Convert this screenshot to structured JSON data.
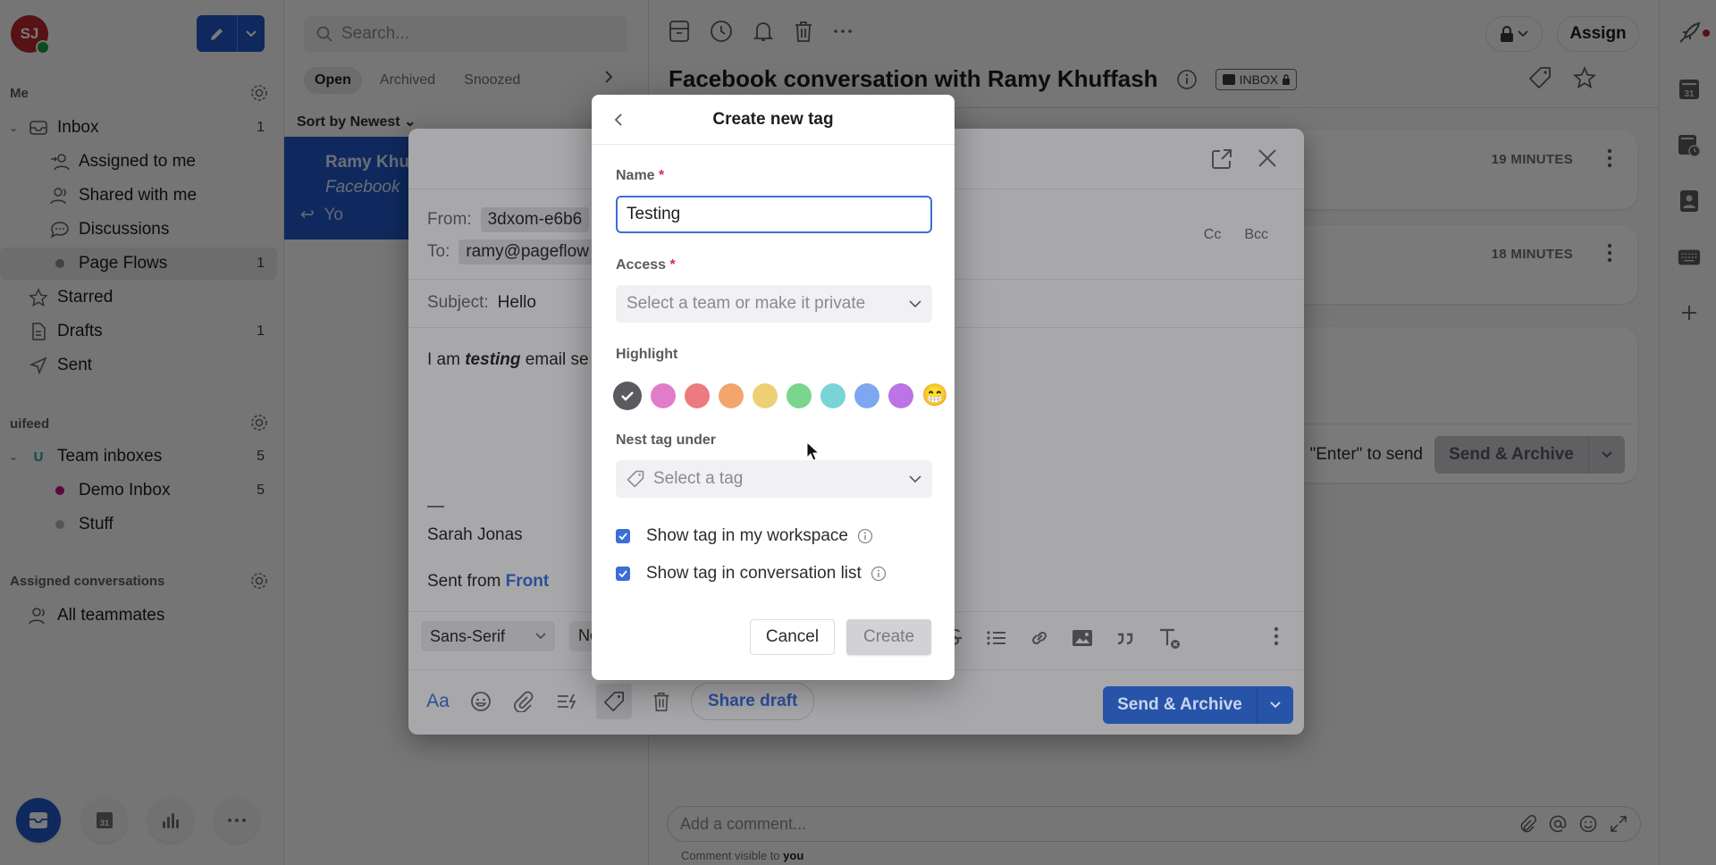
{
  "sidebar": {
    "user_initials": "SJ",
    "section_me": "Me",
    "me_items": [
      {
        "label": "Inbox",
        "count": "1"
      },
      {
        "label": "Assigned to me"
      },
      {
        "label": "Shared with me"
      },
      {
        "label": "Discussions"
      },
      {
        "label": "Page Flows",
        "count": "1",
        "dot_color": "#8a8a8f"
      },
      {
        "label": "Starred"
      },
      {
        "label": "Drafts",
        "count": "1"
      },
      {
        "label": "Sent"
      }
    ],
    "section_workspace": "uifeed",
    "team_inboxes": {
      "label": "Team inboxes",
      "count": "5",
      "badge": "U"
    },
    "team_items": [
      {
        "label": "Demo Inbox",
        "count": "5",
        "dot_color": "#b3157a"
      },
      {
        "label": "Stuff",
        "dot_color": "#b0b0b4"
      }
    ],
    "section_assigned": "Assigned conversations",
    "assigned_items": [
      {
        "label": "All teammates"
      }
    ]
  },
  "list": {
    "search_placeholder": "Search...",
    "tabs": [
      "Open",
      "Archived",
      "Snoozed"
    ],
    "active_tab": "Open",
    "sort_label": "Sort by Newest",
    "item": {
      "name": "Ramy Khu",
      "subtitle": "Facebook",
      "snippet": "Yo"
    }
  },
  "conversation": {
    "title": "Facebook conversation with Ramy Khuffash",
    "inbox_badge": "INBOX",
    "assign_label": "Assign",
    "messages": [
      {
        "time": "19 MINUTES"
      },
      {
        "time": "18 MINUTES"
      }
    ],
    "reply_hint": "\"Enter\" to send",
    "reply_send_label": "Send & Archive",
    "comment_placeholder": "Add a comment...",
    "comment_note_prefix": "Comment visible to ",
    "comment_note_bold": "you"
  },
  "compose": {
    "from_label": "From:",
    "from_value": "3dxom-e6b6",
    "to_label": "To:",
    "to_value": "ramy@pageflow",
    "cc_label": "Cc",
    "bcc_label": "Bcc",
    "subject_label": "Subject:",
    "subject_value": "Hello",
    "body_prefix": "I am ",
    "body_emphasis": "testing",
    "body_suffix": " email se",
    "signature_dash": "—",
    "signature_name": "Sarah Jonas",
    "signature_sent_prefix": "Sent from ",
    "signature_link": "Front",
    "font_family_value": "Sans-Serif",
    "font_size_value": "Ne",
    "format_aa": "Aa",
    "share_draft_label": "Share draft",
    "send_label": "Send & Archive"
  },
  "dialog": {
    "title": "Create new tag",
    "name_label": "Name",
    "name_value": "Testing",
    "access_label": "Access",
    "access_placeholder": "Select a team or make it private",
    "highlight_label": "Highlight",
    "highlight_colors": [
      "#5a5a5f",
      "#e07cc8",
      "#ec7a7e",
      "#f2a66e",
      "#eecf72",
      "#79d68c",
      "#79d4d8",
      "#7fa6f0",
      "#bb73e6"
    ],
    "selected_color_index": 0,
    "emoji_option": "😁",
    "nest_label": "Nest tag under",
    "nest_placeholder": "Select a tag",
    "show_workspace_label": "Show tag in my workspace",
    "show_workspace_checked": true,
    "show_list_label": "Show tag in conversation list",
    "show_list_checked": true,
    "cancel_label": "Cancel",
    "create_label": "Create",
    "required_mark": "*"
  }
}
